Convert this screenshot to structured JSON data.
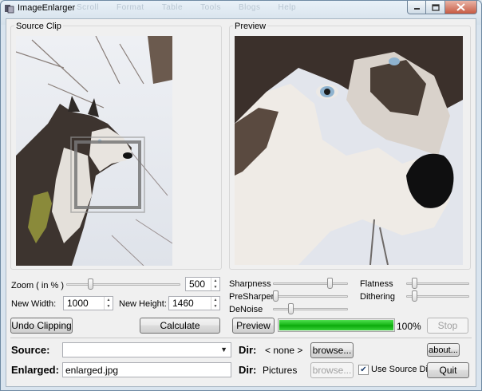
{
  "window": {
    "title": "ImageEnlarger",
    "ghost_menu": [
      "Scroll",
      "Format",
      "Table",
      "Tools",
      "Blogs",
      "Help"
    ]
  },
  "source_clip": {
    "label": "Source Clip"
  },
  "preview_panel": {
    "label": "Preview"
  },
  "zoom": {
    "label": "Zoom ( in % )",
    "value": "500",
    "slider_fraction": 0.2
  },
  "new_width": {
    "label": "New Width:",
    "value": "1000"
  },
  "new_height": {
    "label": "New Height:",
    "value": "1460"
  },
  "buttons": {
    "undo_clipping": "Undo Clipping",
    "calculate": "Calculate",
    "preview": "Preview",
    "stop": "Stop",
    "browse_source": "browse...",
    "browse_enlarged": "browse...",
    "about": "about...",
    "quit": "Quit"
  },
  "sharpness": {
    "label": "Sharpness",
    "slider_fraction": 0.78
  },
  "presharpen": {
    "label": "PreSharpen",
    "slider_fraction": 0.0
  },
  "denoise": {
    "label": "DeNoise",
    "slider_fraction": 0.22
  },
  "flatness": {
    "label": "Flatness",
    "slider_fraction": 0.1
  },
  "dithering": {
    "label": "Dithering",
    "slider_fraction": 0.1
  },
  "progress": {
    "percent": 100,
    "label": "100%"
  },
  "source": {
    "label": "Source:",
    "value": "",
    "dir_label": "Dir:",
    "dir_value": "< none >"
  },
  "enlarged": {
    "label": "Enlarged:",
    "value": "enlarged.jpg",
    "dir_label": "Dir:",
    "dir_value": "Pictures"
  },
  "use_source_dir": {
    "label": "Use Source Dir.",
    "checked": true
  },
  "colors": {
    "progress_fill": "#14b414",
    "window_frame": "#6f8aa3"
  },
  "icons": [
    "app-icon",
    "minimize-icon",
    "maximize-icon",
    "close-icon",
    "combo-arrow-icon",
    "checkmark-icon"
  ]
}
